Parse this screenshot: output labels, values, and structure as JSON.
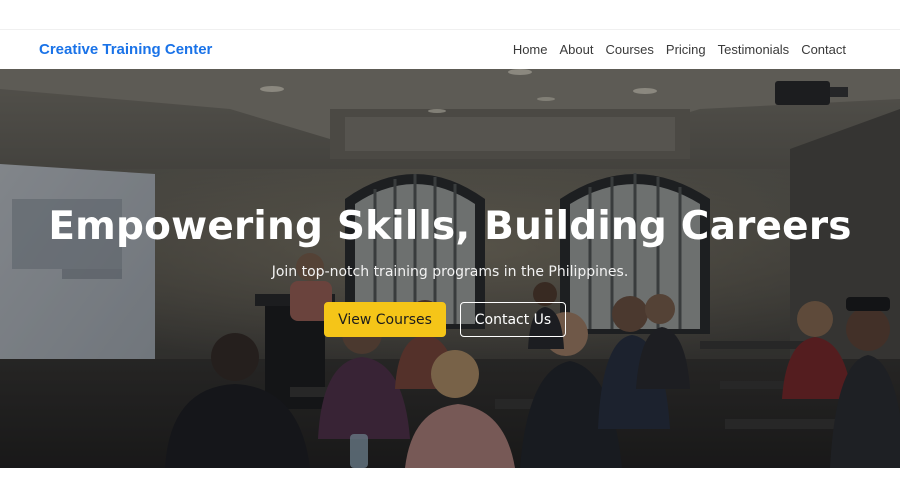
{
  "site": {
    "brand": "Creative Training Center",
    "accent_color": "#1a73e8"
  },
  "nav": {
    "links": [
      "Home",
      "About",
      "Courses",
      "Pricing",
      "Testimonials",
      "Contact"
    ]
  },
  "hero": {
    "title": "Empowering Skills, Building Careers",
    "subtitle": "Join top-notch training programs in the Philippines.",
    "primary_button": "View Courses",
    "secondary_button": "Contact Us",
    "primary_button_color": "#f5c518",
    "background": "classroom-training-photo"
  }
}
